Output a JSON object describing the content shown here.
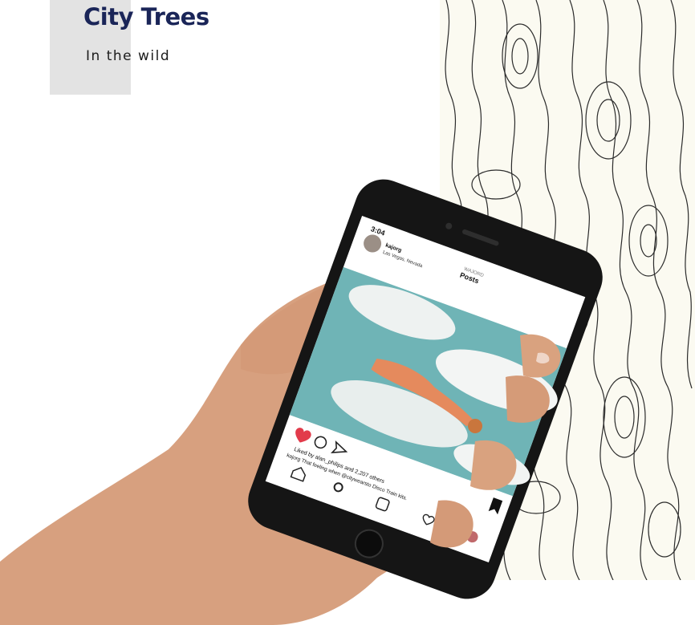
{
  "header": {
    "title": "City Trees",
    "subtitle": "In the wild"
  },
  "phone": {
    "time": "3:04",
    "account": "WAJORD",
    "screen_title": "Posts",
    "username": "kajorg",
    "location": "Las Vegas, Nevada",
    "likes_text": "Liked by alan_philips and 2,207 others",
    "caption": "kajorg That feeling when @citywearsto Disco Train kits.",
    "tag": "citywearsto"
  },
  "colors": {
    "title": "#1a2558",
    "pattern_bg": "#fbfaf1",
    "skin": "#d9a07e",
    "sky": "#6fb4b6",
    "phone_body": "#1a1a1a"
  }
}
